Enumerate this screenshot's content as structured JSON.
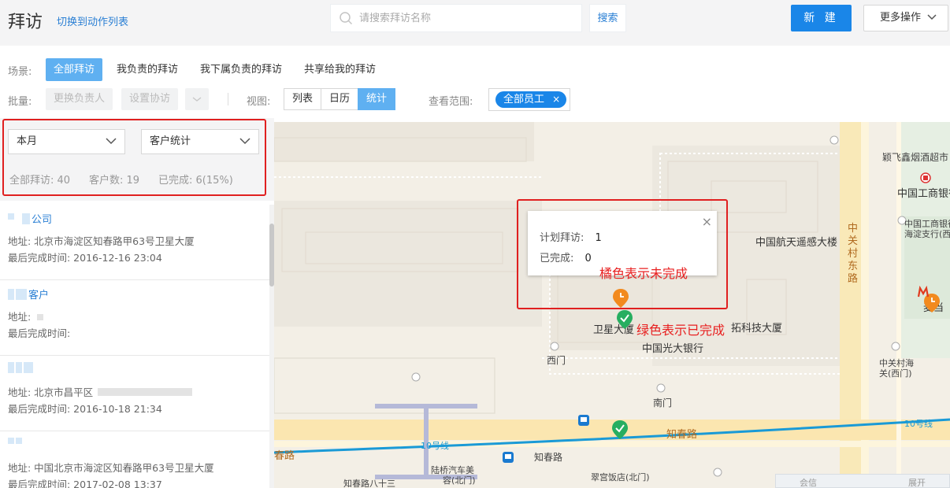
{
  "header": {
    "title": "拜访",
    "switch_link": "切换到动作列表",
    "search_placeholder": "请搜索拜访名称",
    "search_button": "搜索",
    "new_button": "新 建",
    "more_button": "更多操作"
  },
  "scene": {
    "label": "场景:",
    "tabs": [
      "全部拜访",
      "我负责的拜访",
      "我下属负责的拜访",
      "共享给我的拜访"
    ],
    "active": 0
  },
  "batch": {
    "label": "批量:",
    "change_owner": "更换负责人",
    "set_assist": "设置协访"
  },
  "view": {
    "label": "视图:",
    "tabs": [
      "列表",
      "日历",
      "统计"
    ],
    "active": 2
  },
  "scope": {
    "label": "查看范围:",
    "tag": "全部员工"
  },
  "filters": {
    "period": "本月",
    "stat_type": "客户统计"
  },
  "stats": {
    "all": "全部拜访: 40",
    "customers": "客户数: 19",
    "completed": "已完成: 6(15%)"
  },
  "list": [
    {
      "name": "公司",
      "address": "地址:  北京市海淀区知春路甲63号卫星大厦",
      "last": "最后完成时间:    2016-12-16 23:04"
    },
    {
      "name": "客户",
      "address": "地址:",
      "last": "最后完成时间:"
    },
    {
      "name": "",
      "address": "地址:  北京市昌平区",
      "last": "最后完成时间:    2016-10-18 21:34"
    },
    {
      "name": "",
      "address": "地址:  中国北京市海淀区知春路甲63号卫星大厦",
      "last": "最后完成时间:    2017-02-08 13:37"
    }
  ],
  "popup": {
    "plan_label": "计划拜访:",
    "plan_value": "1",
    "done_label": "已完成:",
    "done_value": "0"
  },
  "annotations": {
    "orange": "橘色表示未完成",
    "green": "绿色表示已完成"
  },
  "map": {
    "labels": {
      "hotel": "颖飞鑫烟酒超市",
      "icbc": "中国工商银行",
      "icbc_branch_1": "中国工商银行",
      "icbc_branch_2": "海淀支行(西",
      "remote": "中国航天遥感大楼",
      "satellite": "卫星大厦",
      "tech": "拓科技大厦",
      "everbright": "中国光大银行",
      "west_gate": "西门",
      "south_gate": "南门",
      "zgc_east": "中关村东路",
      "zgc_village_1": "中关村海",
      "zgc_village_2": "关(西门)",
      "zhichun": "知春路",
      "zhichun2": "知春路",
      "zhichun_left": "春路",
      "line10_a": "10号线",
      "line10_b": "10号线",
      "lutong": "陆桥汽车美",
      "lutong2": "容(北门)",
      "cuigong": "翠宫饭店(北门)",
      "zcl8": "知春路八十三",
      "mcd": "麦当",
      "chat": "会信",
      "expand": "展开"
    },
    "colors": {
      "orange_pin": "#f28a1e",
      "green_pin": "#27ae60",
      "metro": "#1a9ad6"
    }
  }
}
